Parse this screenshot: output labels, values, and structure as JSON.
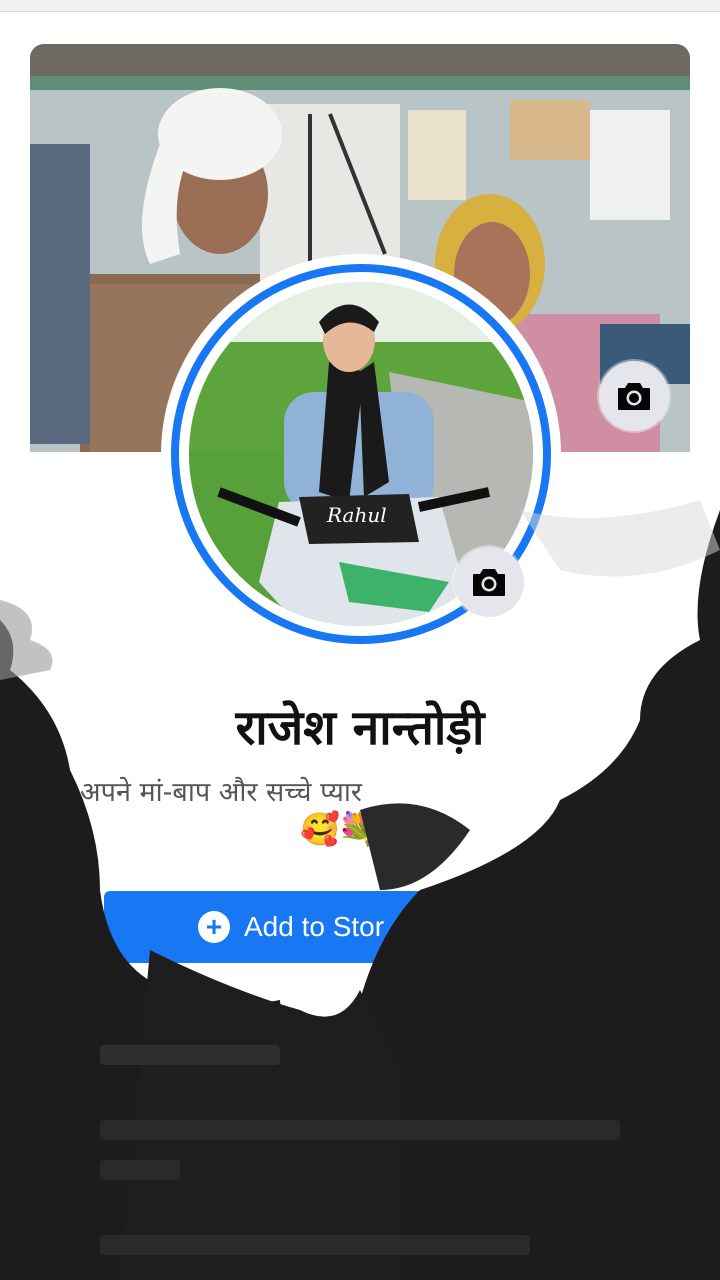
{
  "profile": {
    "name": "राजेश नान्तोड़ी",
    "bio": "अपने मां-बाप और सच्चे प्यार",
    "bio_emojis": "🥰💐❤️"
  },
  "actions": {
    "add_story_label": "Add to Stor",
    "add_story_icon": "plus-circle-icon"
  },
  "icons": {
    "cover_camera": "camera-icon",
    "profile_camera": "camera-icon"
  },
  "photo": {
    "bike_label": "Rahul"
  },
  "colors": {
    "accent": "#1877f2",
    "background": "#ffffff",
    "smoke": "#1c1c1c"
  }
}
